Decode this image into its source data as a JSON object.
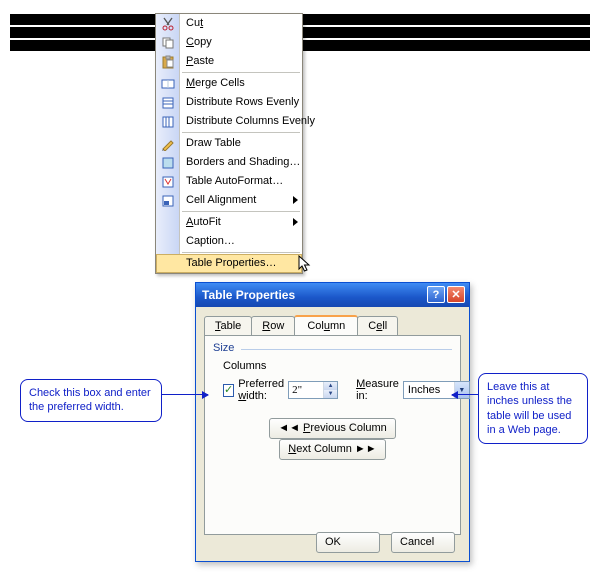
{
  "context_menu": {
    "items": [
      {
        "label": "Cut",
        "k": "t",
        "icon": "cut",
        "sub": false
      },
      {
        "label": "Copy",
        "k": "C",
        "icon": "copy",
        "sub": false
      },
      {
        "label": "Paste",
        "k": "P",
        "icon": "paste",
        "sub": false
      },
      {
        "sep": true
      },
      {
        "label": "Merge Cells",
        "k": "M",
        "icon": "merge",
        "sub": false
      },
      {
        "label": "Distribute Rows Evenly",
        "k": "",
        "icon": "dist-rows",
        "sub": false
      },
      {
        "label": "Distribute Columns Evenly",
        "k": "",
        "icon": "dist-cols",
        "sub": false
      },
      {
        "sep": true
      },
      {
        "label": "Draw Table",
        "k": "",
        "icon": "draw",
        "sub": false
      },
      {
        "label": "Borders and Shading…",
        "k": "",
        "icon": "borders",
        "sub": false
      },
      {
        "label": "Table AutoFormat…",
        "k": "",
        "icon": "autoformat",
        "sub": false
      },
      {
        "label": "Cell Alignment",
        "k": "",
        "icon": "align",
        "sub": true
      },
      {
        "sep": true
      },
      {
        "label": "AutoFit",
        "k": "A",
        "icon": "",
        "sub": true
      },
      {
        "label": "Caption…",
        "k": "",
        "icon": "",
        "sub": false
      },
      {
        "sep": true
      },
      {
        "label": "Table Properties…",
        "k": "",
        "icon": "",
        "sub": false,
        "hover": true
      }
    ]
  },
  "dialog": {
    "title": "Table Properties",
    "tabs": [
      "Table",
      "Row",
      "Column",
      "Cell"
    ],
    "active_tab": "Column",
    "group": "Size",
    "subgroup": "Columns",
    "pref_checked": true,
    "pref_label": "Preferred width:",
    "pref_value": "2\"",
    "measure_label": "Measure in:",
    "measure_value": "Inches",
    "prev_btn": "◄◄ Previous Column",
    "next_btn": "Next Column ►►",
    "ok": "OK",
    "cancel": "Cancel"
  },
  "callouts": {
    "left": "Check this box and enter the preferred width.",
    "right": "Leave this at inches unless the table will be used in a Web page."
  }
}
